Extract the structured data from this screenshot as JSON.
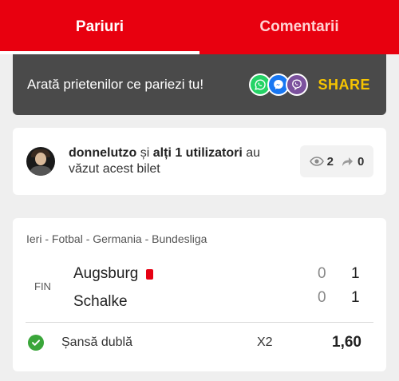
{
  "tabs": [
    {
      "label": "Pariuri",
      "active": true
    },
    {
      "label": "Comentarii",
      "active": false
    }
  ],
  "share": {
    "text": "Arată prietenilor ce pariezi tu!",
    "button_label": "SHARE",
    "icons": [
      "whatsapp-icon",
      "messenger-icon",
      "viber-icon"
    ]
  },
  "viewers": {
    "username": "donnelutzo",
    "and_text": " și ",
    "others": "alți 1 utilizatori",
    "suffix": " au văzut acest bilet",
    "views": "2",
    "shares": "0"
  },
  "match": {
    "league": "Ieri - Fotbal - Germania - Bundesliga",
    "status": "FIN",
    "home": {
      "name": "Augsburg",
      "score_ht": "0",
      "score_ft": "1",
      "red_card": true
    },
    "away": {
      "name": "Schalke",
      "score_ht": "0",
      "score_ft": "1"
    },
    "bet": {
      "market": "Șansă dublă",
      "selection": "X2",
      "odds": "1,60",
      "won": true
    }
  },
  "colors": {
    "brand_red": "#e8000f",
    "share_yellow": "#f6c400",
    "win_green": "#3aa63a",
    "share_bar": "#4a4a4a"
  }
}
